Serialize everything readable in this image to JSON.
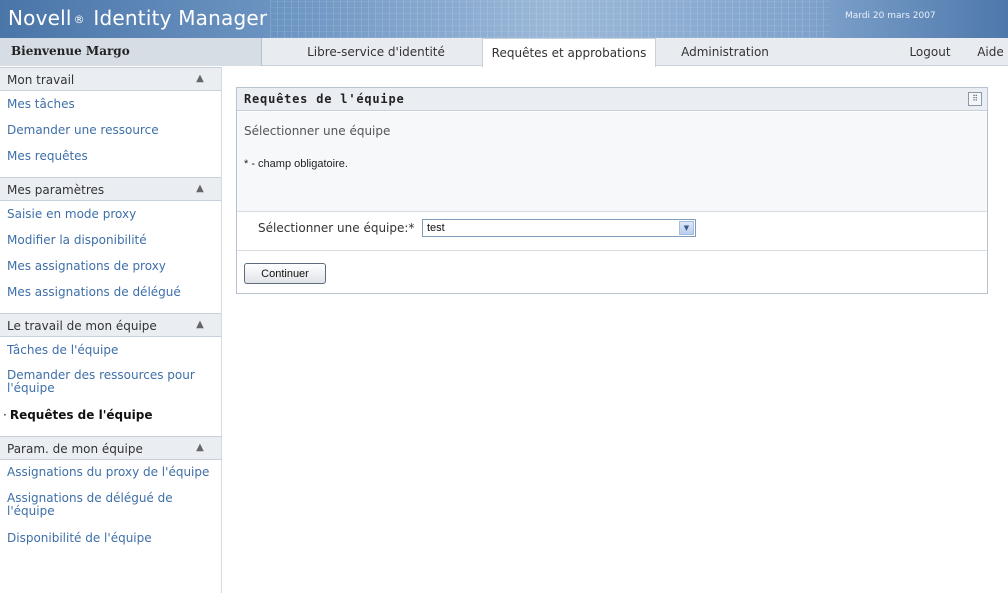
{
  "header": {
    "app_name": "Novell",
    "registered_mark": "®",
    "app_product": "Identity Manager",
    "date": "Mardi 20 mars 2007"
  },
  "nav": {
    "welcome": "Bienvenue Margo",
    "tabs": [
      {
        "label": "Libre-service d'identité",
        "active": false
      },
      {
        "label": "Requêtes et approbations",
        "active": true
      },
      {
        "label": "Administration",
        "active": false
      }
    ],
    "logout": "Logout",
    "help": "Aide"
  },
  "sidebar": {
    "sections": [
      {
        "title": "Mon travail",
        "items": [
          "Mes tâches",
          "Demander une ressource",
          "Mes requêtes"
        ]
      },
      {
        "title": "Mes paramètres",
        "items": [
          "Saisie en mode proxy",
          "Modifier la disponibilité",
          "Mes assignations de proxy",
          "Mes assignations de délégué"
        ]
      },
      {
        "title": "Le travail de mon équipe",
        "items": [
          "Tâches de l'équipe",
          "Demander des ressources pour l'équipe",
          "Requêtes de l'équipe"
        ],
        "current_index": 2
      },
      {
        "title": "Param. de mon équipe",
        "items": [
          "Assignations du proxy de l'équipe",
          "Assignations de délégué de l'équipe",
          "Disponibilité de l'équipe"
        ]
      }
    ]
  },
  "panel": {
    "title": "Requêtes de l'équipe",
    "subtitle": "Sélectionner une équipe",
    "required_note": "* - champ obligatoire.",
    "field_label": "Sélectionner une équipe:*",
    "select_value": "test",
    "continue_button": "Continuer"
  },
  "colors": {
    "header_blue": "#4a75a8",
    "link_blue": "#3e6fa8",
    "section_bg": "#eaeef3"
  }
}
